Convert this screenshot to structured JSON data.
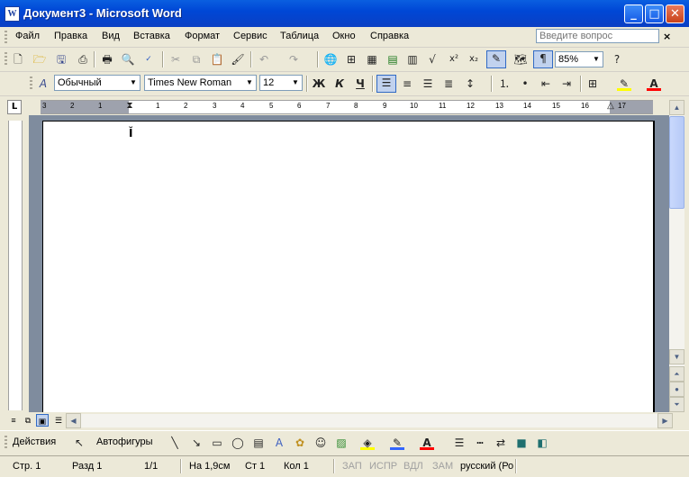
{
  "window": {
    "title": "Документ3 - Microsoft Word",
    "app_icon_letter": "W",
    "minimize_glyph": "_",
    "maximize_glyph": "□",
    "close_glyph": "✕"
  },
  "menubar": {
    "items": [
      "Файл",
      "Правка",
      "Вид",
      "Вставка",
      "Формат",
      "Сервис",
      "Таблица",
      "Окно",
      "Справка"
    ],
    "ask_placeholder": "Введите вопрос",
    "close_doc_glyph": "×"
  },
  "standard_toolbar": {
    "zoom": "85%"
  },
  "formatting_toolbar": {
    "style": "Обычный",
    "font": "Times New Roman",
    "size": "12",
    "bold_label": "Ж",
    "italic_label": "К",
    "underline_label": "Ч"
  },
  "ruler": {
    "corner_glyph": "L",
    "numbers": [
      "3",
      "2",
      "1",
      "1",
      "2",
      "3",
      "4",
      "5",
      "6",
      "7",
      "8",
      "9",
      "10",
      "11",
      "12",
      "13",
      "14",
      "15",
      "16",
      "17"
    ]
  },
  "drawing_toolbar": {
    "actions_label": "Действия",
    "autoshapes_label": "Автофигуры"
  },
  "statusbar": {
    "page": "Стр. 1",
    "section": "Разд 1",
    "pages": "1/1",
    "at": "На 1,9см",
    "line": "Ст 1",
    "col": "Кол 1",
    "rec": "ЗАП",
    "trk": "ИСПР",
    "ext": "ВДЛ",
    "ovr": "ЗАМ",
    "language": "русский (Ро"
  },
  "colors": {
    "titlebar": "#0a5fe0",
    "chrome": "#ece9d8",
    "workspace": "#7f8c9e",
    "highlight_yellow": "#ffff00",
    "font_red": "#ff0000"
  }
}
